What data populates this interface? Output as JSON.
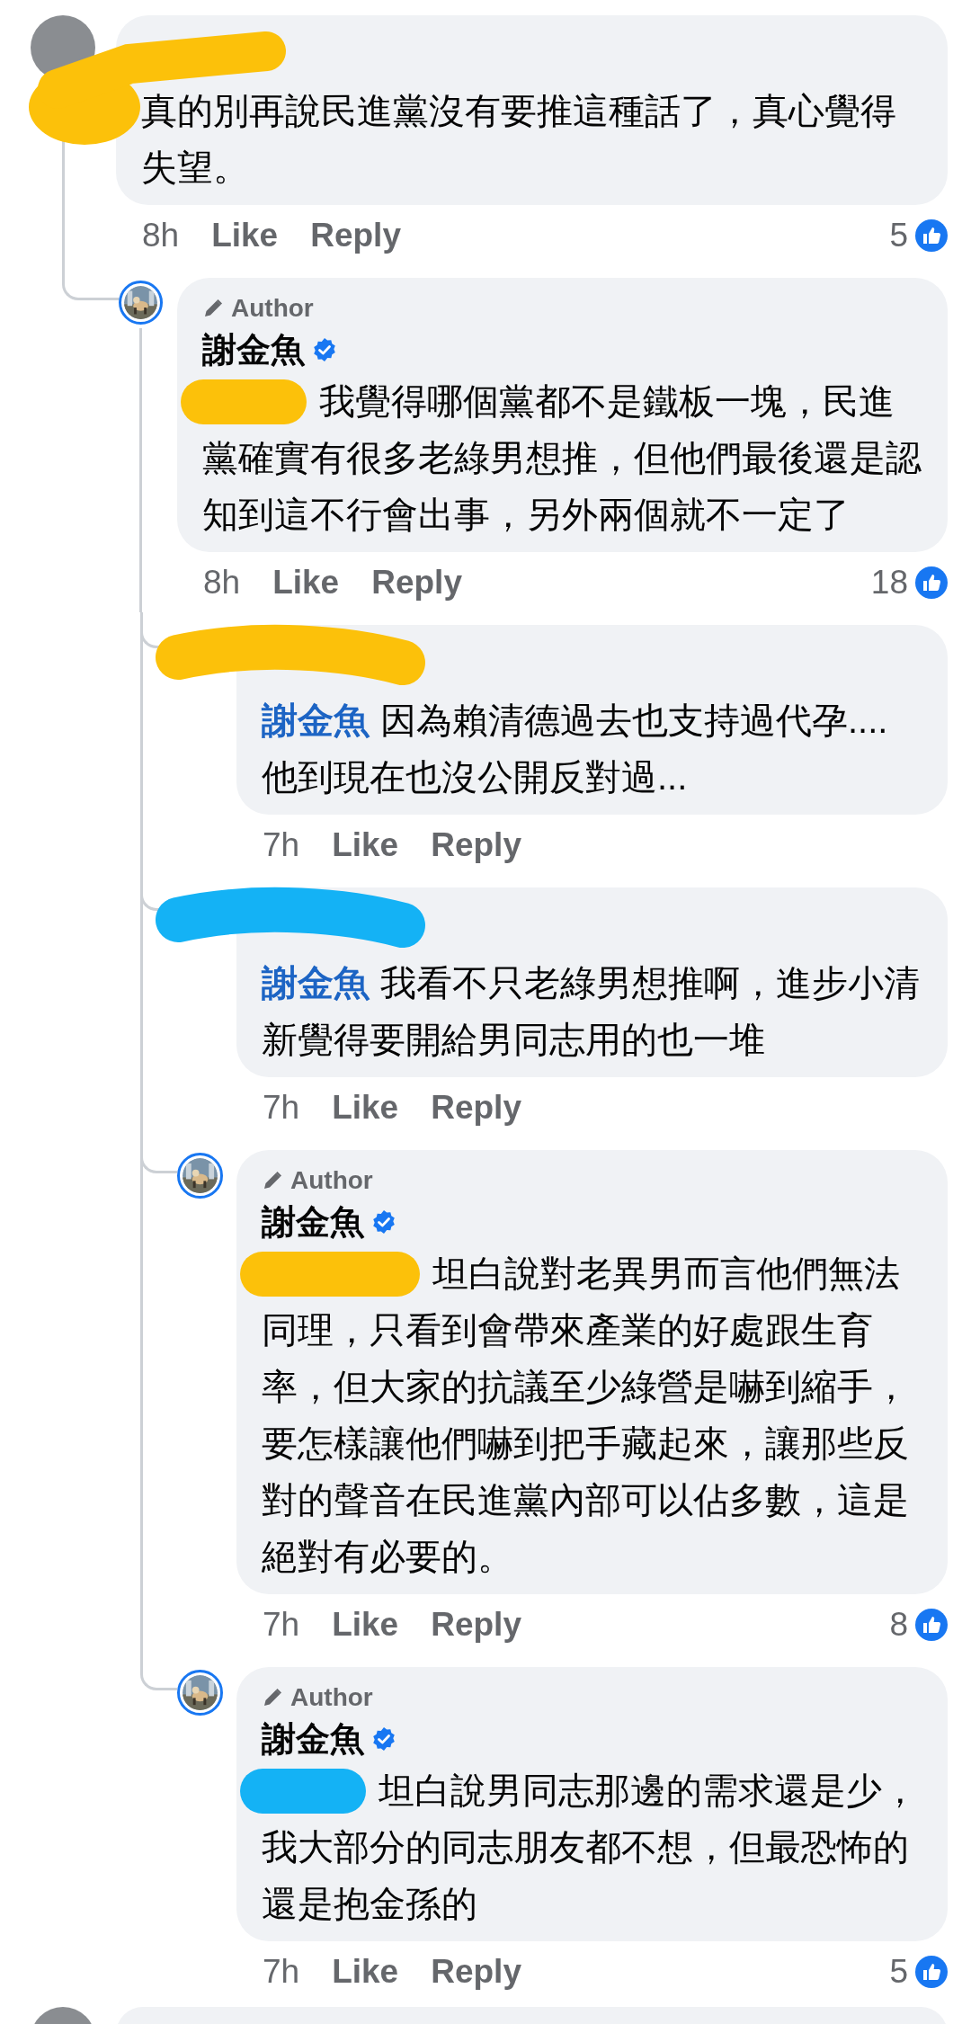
{
  "comments": [
    {
      "kind": "comment",
      "name_redaction": {
        "color": "#fcc10a"
      },
      "text": "真的別再說民進黨沒有要推這種話了，真心覺得失望。",
      "time": "8h",
      "like": "Like",
      "reply": "Reply",
      "reactions": "5",
      "replies": [
        {
          "kind": "comment",
          "author_tag": "Author",
          "name": "謝金魚",
          "verified": true,
          "mention_redaction": {
            "color": "#fcc10a"
          },
          "text": "我覺得哪個黨都不是鐵板一塊，民進黨確實有很多老綠男想推，但他們最後還是認知到這不行會出事，另外兩個就不一定了",
          "time": "8h",
          "like": "Like",
          "reply": "Reply",
          "reactions": "18",
          "replies": [
            {
              "kind": "comment",
              "name_redaction": {
                "color": "#fcc10a"
              },
              "mention": "謝金魚",
              "text": "因為賴清德過去也支持過代孕....他到現在也沒公開反對過...",
              "time": "7h",
              "like": "Like",
              "reply": "Reply"
            },
            {
              "kind": "comment",
              "name_redaction": {
                "color": "#14b2f5"
              },
              "mention": "謝金魚",
              "text": "我看不只老綠男想推啊，進步小清新覺得要開給男同志用的也一堆",
              "time": "7h",
              "like": "Like",
              "reply": "Reply"
            },
            {
              "kind": "comment",
              "author_tag": "Author",
              "name": "謝金魚",
              "verified": true,
              "mention_redaction": {
                "color": "#fcc10a"
              },
              "text": "坦白說對老異男而言他們無法同理，只看到會帶來產業的好處跟生育率，但大家的抗議至少綠營是嚇到縮手，要怎樣讓他們嚇到把手藏起來，讓那些反對的聲音在民進黨內部可以佔多數，這是絕對有必要的。",
              "time": "7h",
              "like": "Like",
              "reply": "Reply",
              "reactions": "8"
            },
            {
              "kind": "comment",
              "author_tag": "Author",
              "name": "謝金魚",
              "verified": true,
              "mention_redaction": {
                "color": "#14b2f5"
              },
              "text": "坦白說男同志那邊的需求還是少，我大部分的同志朋友都不想，但最恐怖的還是抱金孫的",
              "time": "7h",
              "like": "Like",
              "reply": "Reply",
              "reactions": "5"
            }
          ]
        }
      ]
    },
    {
      "kind": "partial"
    }
  ]
}
